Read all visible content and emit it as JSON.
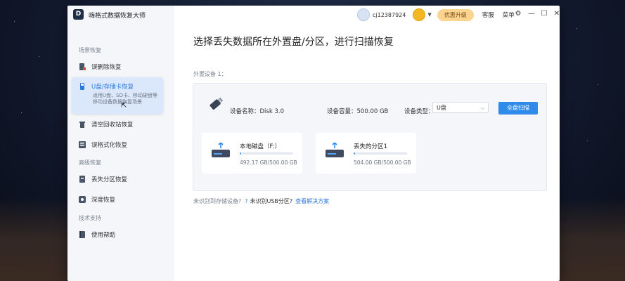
{
  "app": {
    "logo_letter": "D",
    "title": "嗨格式数据恢复大师"
  },
  "topbar": {
    "user_id": "cj12387924",
    "vip_button": "优惠升级",
    "service": "客服",
    "menu": "菜单"
  },
  "window_controls": {
    "settings": "⚙",
    "minimize": "—",
    "maximize": "☐",
    "close": "✕"
  },
  "sidebar": {
    "section1": "场景恢复",
    "section2": "高级恢复",
    "section3": "技术支持",
    "items": [
      {
        "label": "误删除恢复",
        "icon": "file-delete-icon"
      },
      {
        "label": "U盘/存储卡恢复",
        "desc": "适用U盘、SD卡、移动硬盘等移动设备数据恢复场景",
        "icon": "usb-card-icon"
      },
      {
        "label": "清空回收站恢复",
        "icon": "recycle-bin-icon"
      },
      {
        "label": "误格式化恢复",
        "icon": "format-icon"
      },
      {
        "label": "丢失分区恢复",
        "icon": "partition-icon"
      },
      {
        "label": "深度恢复",
        "icon": "deep-scan-icon"
      },
      {
        "label": "使用帮助",
        "icon": "help-book-icon"
      }
    ]
  },
  "main": {
    "title": "选择丢失数据所在外置盘/分区，进行扫描恢复",
    "device_section_label": "外置设备 1："
  },
  "device": {
    "name_label": "设备名称：",
    "name": "Disk 3.0",
    "capacity_label": "设备容量：",
    "capacity": "500.00 GB",
    "type_label": "设备类型：",
    "type": "U盘",
    "scan_button": "全盘扫描"
  },
  "partitions": [
    {
      "name": "本地磁盘（F:）",
      "size": "492.17 GB/500.00 GB",
      "used_fraction": 0.02
    },
    {
      "name": "丢失的分区1",
      "size": "504.00 GB/500.00 GB",
      "used_fraction": 0.02
    }
  ],
  "footer": {
    "prompt": "未识别到存储设备?",
    "help_text": "未识别USB分区?",
    "link": "查看解决方案"
  },
  "colors": {
    "accent": "#2f8ae9",
    "vip": "#fbd58f",
    "active_bg": "#dbe8fb"
  }
}
